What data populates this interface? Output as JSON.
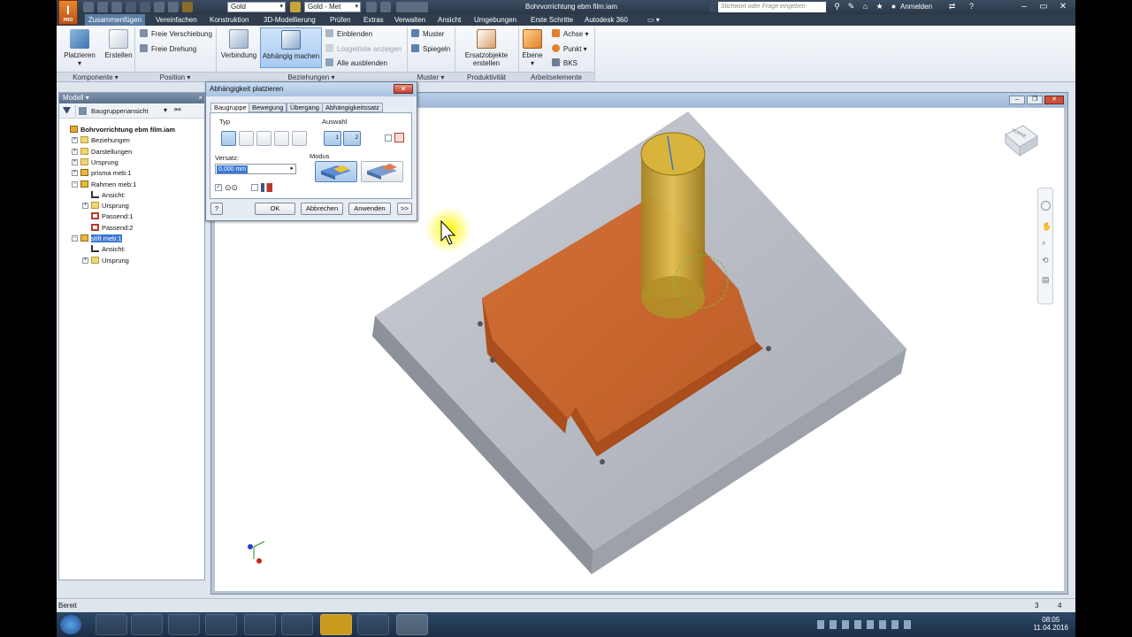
{
  "titlebar": {
    "app_logo": "I",
    "app_logo_sub": "PRO",
    "material_combo": "Gold",
    "appearance_combo": "Gold - Met",
    "document_title": "Bohrvorrichtung ebm film.iam",
    "search_placeholder": "Stichwort oder Frage eingeben",
    "signin_label": "Anmelden"
  },
  "tabs": [
    "Zusammenfügen",
    "Vereinfachen",
    "Konstruktion",
    "3D-Modellierung",
    "Prüfen",
    "Extras",
    "Verwalten",
    "Ansicht",
    "Umgebungen",
    "Erste Schritte",
    "Autodesk 360"
  ],
  "ribbon": {
    "komponente": {
      "label": "Komponente ▾",
      "platzieren": "Platzieren",
      "erstellen": "Erstellen"
    },
    "position": {
      "label": "Position ▾",
      "freie_verschiebung": "Freie Verschiebung",
      "freie_drehung": "Freie Drehung"
    },
    "beziehungen": {
      "label": "Beziehungen ▾",
      "verbindung": "Verbindung",
      "abhaengig": "Abhängig machen",
      "einblenden": "Einblenden",
      "losgeloeste": "Losgelöste anzeigen",
      "alle_ausblenden": "Alle ausblenden"
    },
    "muster": {
      "label": "Muster ▾",
      "muster": "Muster",
      "spiegeln": "Spiegeln"
    },
    "produktivitaet": {
      "label": "Produktivität",
      "ersatz_line1": "Ersatzobjekte",
      "ersatz_line2": "erstellen"
    },
    "arbeitselemente": {
      "label": "Arbeitselemente",
      "ebene": "Ebene",
      "achse": "Achse ▾",
      "punkt": "Punkt ▾",
      "bks": "BKS"
    }
  },
  "browser": {
    "header": "Modell ▾",
    "view_combo": "Baugruppenansicht",
    "items": [
      {
        "label": "Bohrvorrichtung ebm film.iam",
        "indent": 0,
        "icon": "assembly-icon",
        "bold": true,
        "expander": ""
      },
      {
        "label": "Beziehungen",
        "indent": 1,
        "icon": "folder-icon",
        "expander": "+"
      },
      {
        "label": "Darstellungen",
        "indent": 1,
        "icon": "folder-icon",
        "expander": "+"
      },
      {
        "label": "Ursprung",
        "indent": 1,
        "icon": "folder-icon",
        "expander": "+"
      },
      {
        "label": "prisma meb:1",
        "indent": 1,
        "icon": "part-icon",
        "expander": "+"
      },
      {
        "label": "Rahmen meb:1",
        "indent": 1,
        "icon": "part-icon",
        "expander": "−"
      },
      {
        "label": "Ansicht:",
        "indent": 2,
        "icon": "view-icon",
        "expander": ""
      },
      {
        "label": "Ursprung",
        "indent": 2,
        "icon": "folder-icon",
        "expander": "+"
      },
      {
        "label": "Passend:1",
        "indent": 2,
        "icon": "mate-icon",
        "expander": ""
      },
      {
        "label": "Passend:2",
        "indent": 2,
        "icon": "mate-icon",
        "expander": ""
      },
      {
        "label": "stift meb:1",
        "indent": 1,
        "icon": "part-icon",
        "expander": "−",
        "selected": true
      },
      {
        "label": "Ansicht:",
        "indent": 2,
        "icon": "view-icon",
        "expander": ""
      },
      {
        "label": "Ursprung",
        "indent": 2,
        "icon": "folder-icon",
        "expander": "+"
      }
    ]
  },
  "dialog": {
    "title": "Abhängigkeit platzieren",
    "tabs": [
      "Baugruppe",
      "Bewegung",
      "Übergang",
      "Abhängigkeitssatz"
    ],
    "active_tab": 0,
    "typ_label": "Typ",
    "auswahl_label": "Auswahl",
    "auswahl_1": "1",
    "auswahl_2": "2",
    "versatz_label": "Versatz:",
    "versatz_value": "0,000 mm",
    "modus_label": "Modus",
    "help": "?",
    "ok": "OK",
    "abbrechen": "Abbrechen",
    "anwenden": "Anwenden",
    "more": ">>"
  },
  "viewcube": {
    "face_label": "VORNE"
  },
  "status": {
    "text": "Bereit",
    "count_a": "3",
    "count_b": "4"
  },
  "taskbar": {
    "time": "08:05",
    "date": "11.04.2016"
  },
  "colors": {
    "accent": "#5a7da4",
    "plate": "#b9bcc4",
    "block": "#c7662f",
    "pin": "#c9a233",
    "cursor_highlight": "#ffea00"
  }
}
